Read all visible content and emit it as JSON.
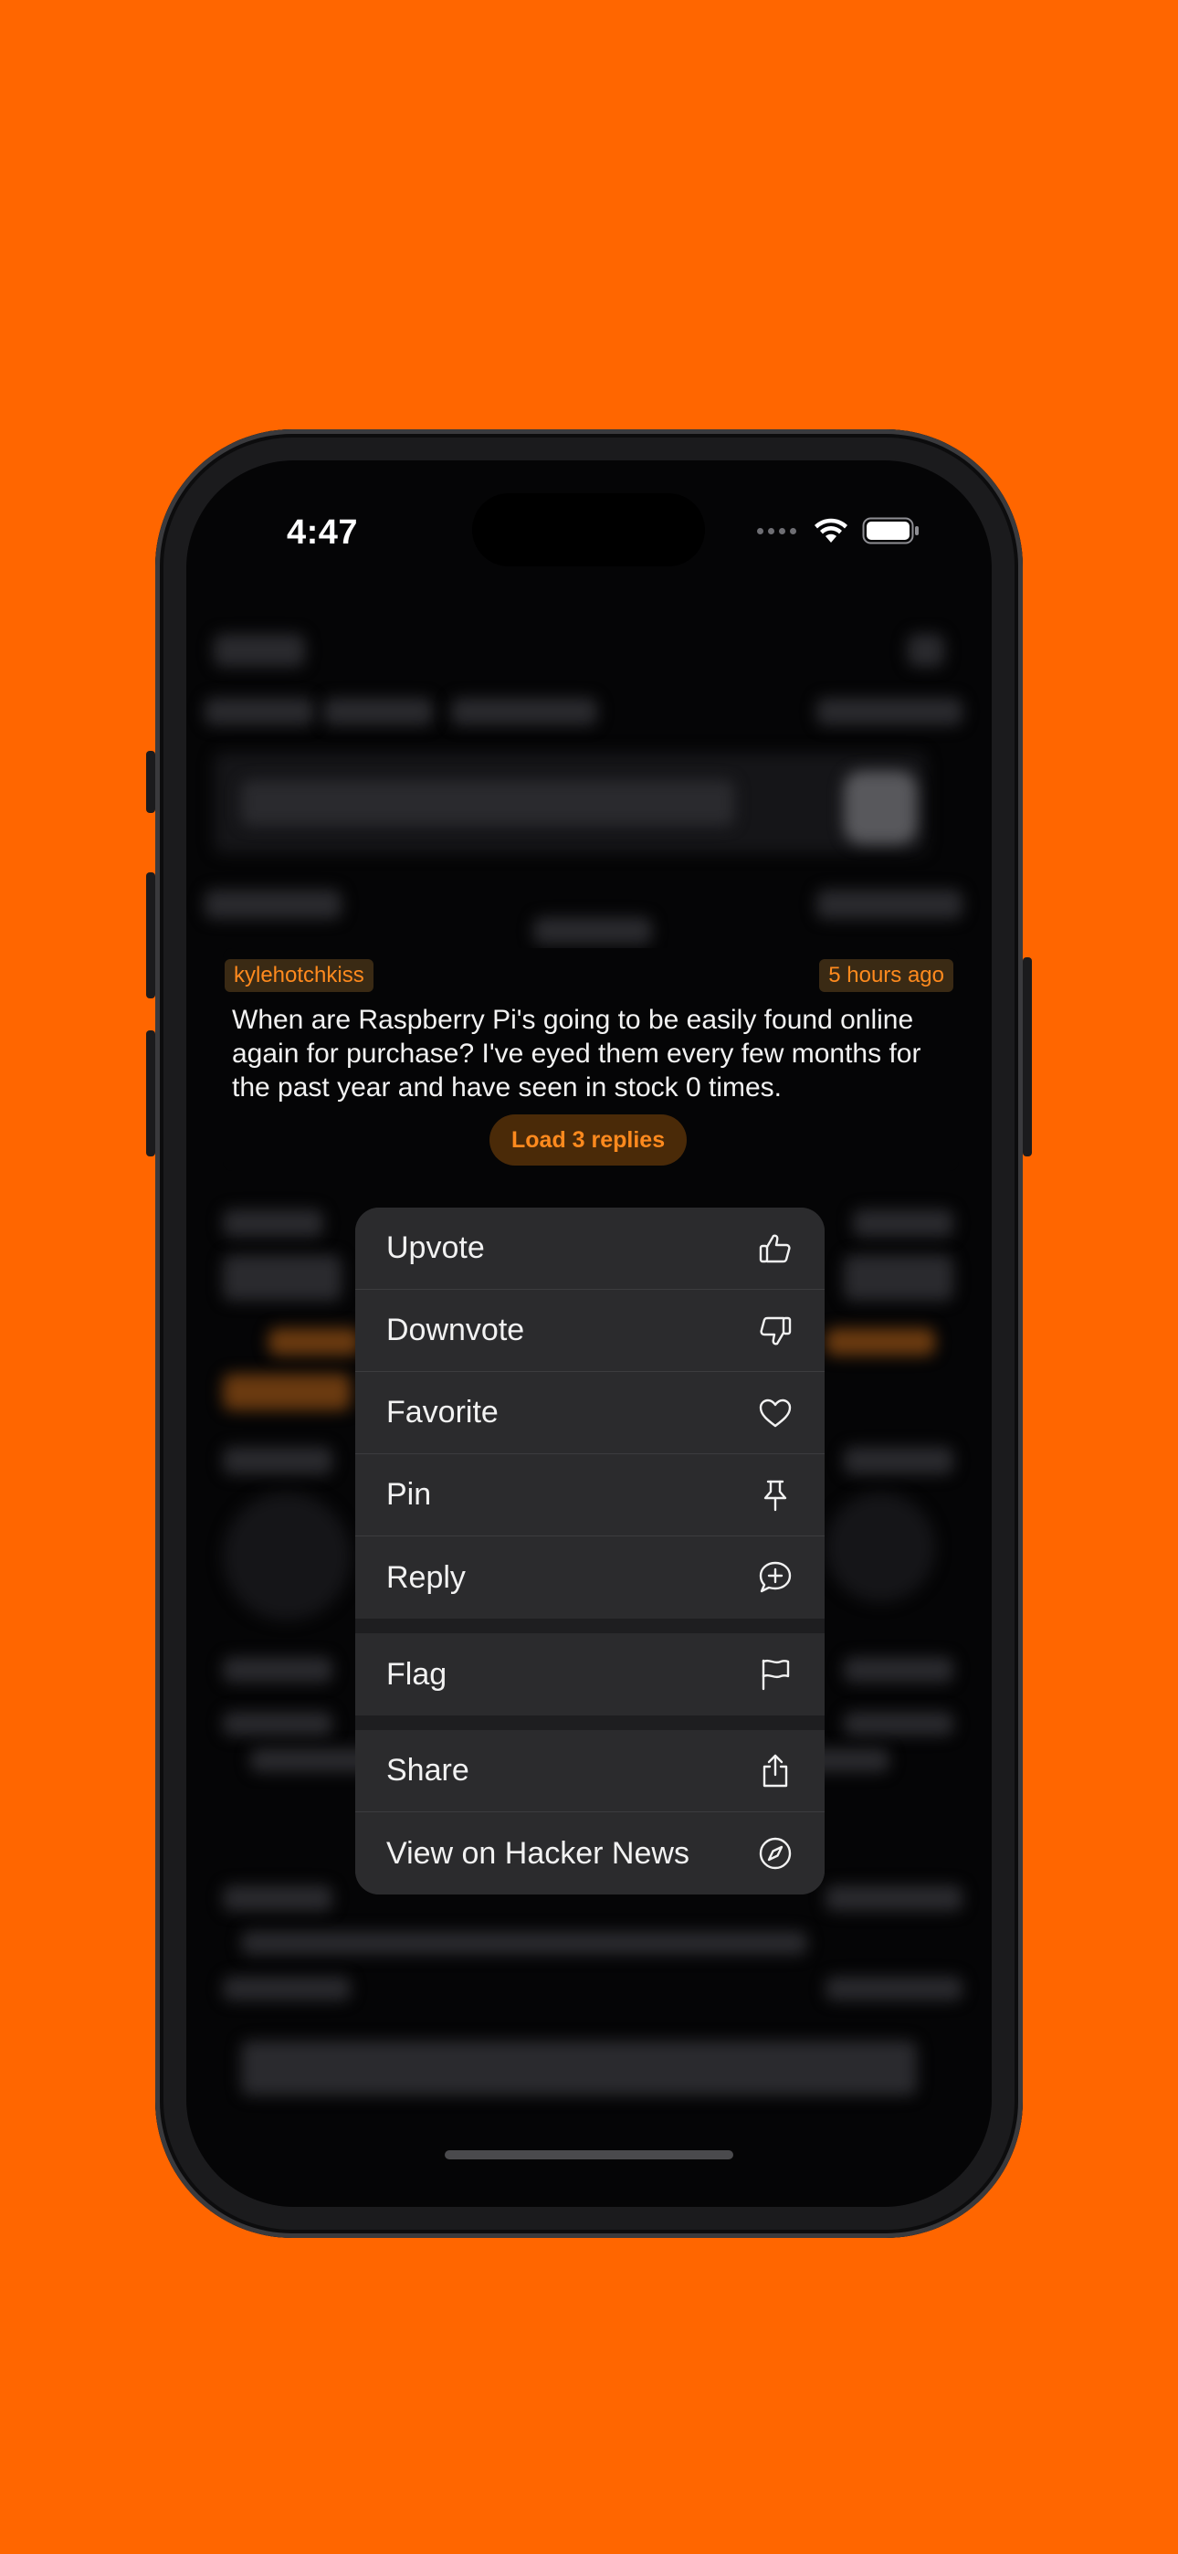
{
  "status_bar": {
    "time": "4:47"
  },
  "comment": {
    "author": "kylehotchkiss",
    "age": "5 hours ago",
    "text": "When are Raspberry Pi's going to be easily found online again for purchase? I've eyed them every few months for the past year and have seen in stock 0 times.",
    "load_replies_label": "Load 3 replies"
  },
  "context_menu": {
    "upvote": {
      "label": "Upvote",
      "icon": "thumbs-up-icon"
    },
    "downvote": {
      "label": "Downvote",
      "icon": "thumbs-down-icon"
    },
    "favorite": {
      "label": "Favorite",
      "icon": "heart-icon"
    },
    "pin": {
      "label": "Pin",
      "icon": "pin-icon"
    },
    "reply": {
      "label": "Reply",
      "icon": "reply-bubble-icon"
    },
    "flag": {
      "label": "Flag",
      "icon": "flag-icon"
    },
    "share": {
      "label": "Share",
      "icon": "share-icon"
    },
    "view_hn": {
      "label": "View on Hacker News",
      "icon": "compass-icon"
    }
  },
  "colors": {
    "background": "#FF6600",
    "accent": "#FF8A1E",
    "menu_bg": "#2B2B2D",
    "screen_bg": "#050506"
  }
}
